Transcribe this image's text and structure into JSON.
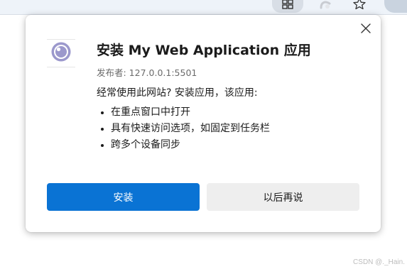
{
  "dialog": {
    "title": "安装 My Web Application 应用",
    "publisher": "发布者: 127.0.0.1:5501",
    "description": "经常使用此网站? 安装应用，该应用:",
    "features": [
      "在重点窗口中打开",
      "具有快速访问选项，如固定到任务栏",
      "跨多个设备同步"
    ],
    "install_label": "安装",
    "later_label": "以后再说"
  },
  "watermark": "CSDN @._Hain.",
  "colors": {
    "accent": "#0a73d4",
    "secondary_button": "#eeeeee",
    "app_icon": "#9b98cc"
  },
  "icons": {
    "toolbar": [
      "apps-icon",
      "extension-icon",
      "favorites-star-icon"
    ],
    "dialog": [
      "app-icon",
      "close-icon"
    ]
  }
}
